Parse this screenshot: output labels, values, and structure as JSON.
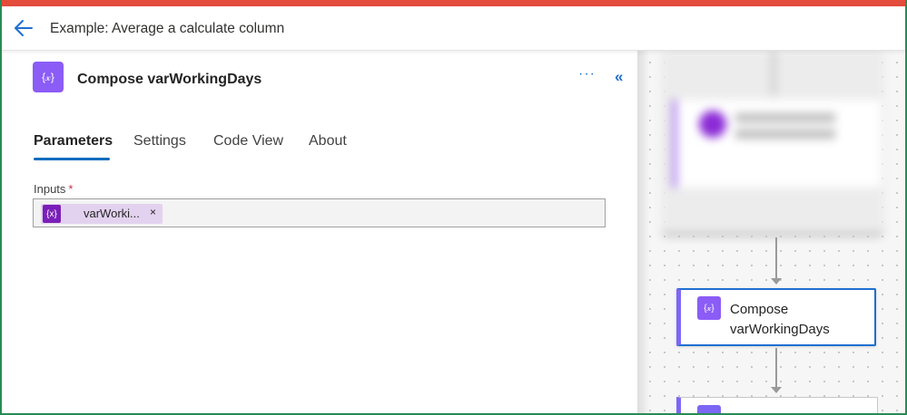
{
  "header": {
    "title": "Example: Average a calculate column"
  },
  "panel": {
    "action_title": "Compose varWorkingDays",
    "action_icon_glyph": "{𝓍}",
    "more_label": "···",
    "collapse_label": "«",
    "tabs": [
      {
        "label": "Parameters",
        "active": true
      },
      {
        "label": "Settings",
        "active": false
      },
      {
        "label": "Code View",
        "active": false
      },
      {
        "label": "About",
        "active": false
      }
    ],
    "inputs_label": "Inputs",
    "required_marker": "*",
    "token": {
      "icon_glyph": "{x}",
      "text": "varWorki...",
      "remove_label": "×"
    }
  },
  "canvas": {
    "node_title": "Compose varWorkingDays",
    "node_icon_glyph": "{𝓍}"
  },
  "colors": {
    "accent_blue": "#0f6cbd",
    "action_purple": "#8b5cf6",
    "token_bg": "#e3d2ef",
    "top_bar": "#e34b3a",
    "frame_green": "#2a8a55"
  }
}
